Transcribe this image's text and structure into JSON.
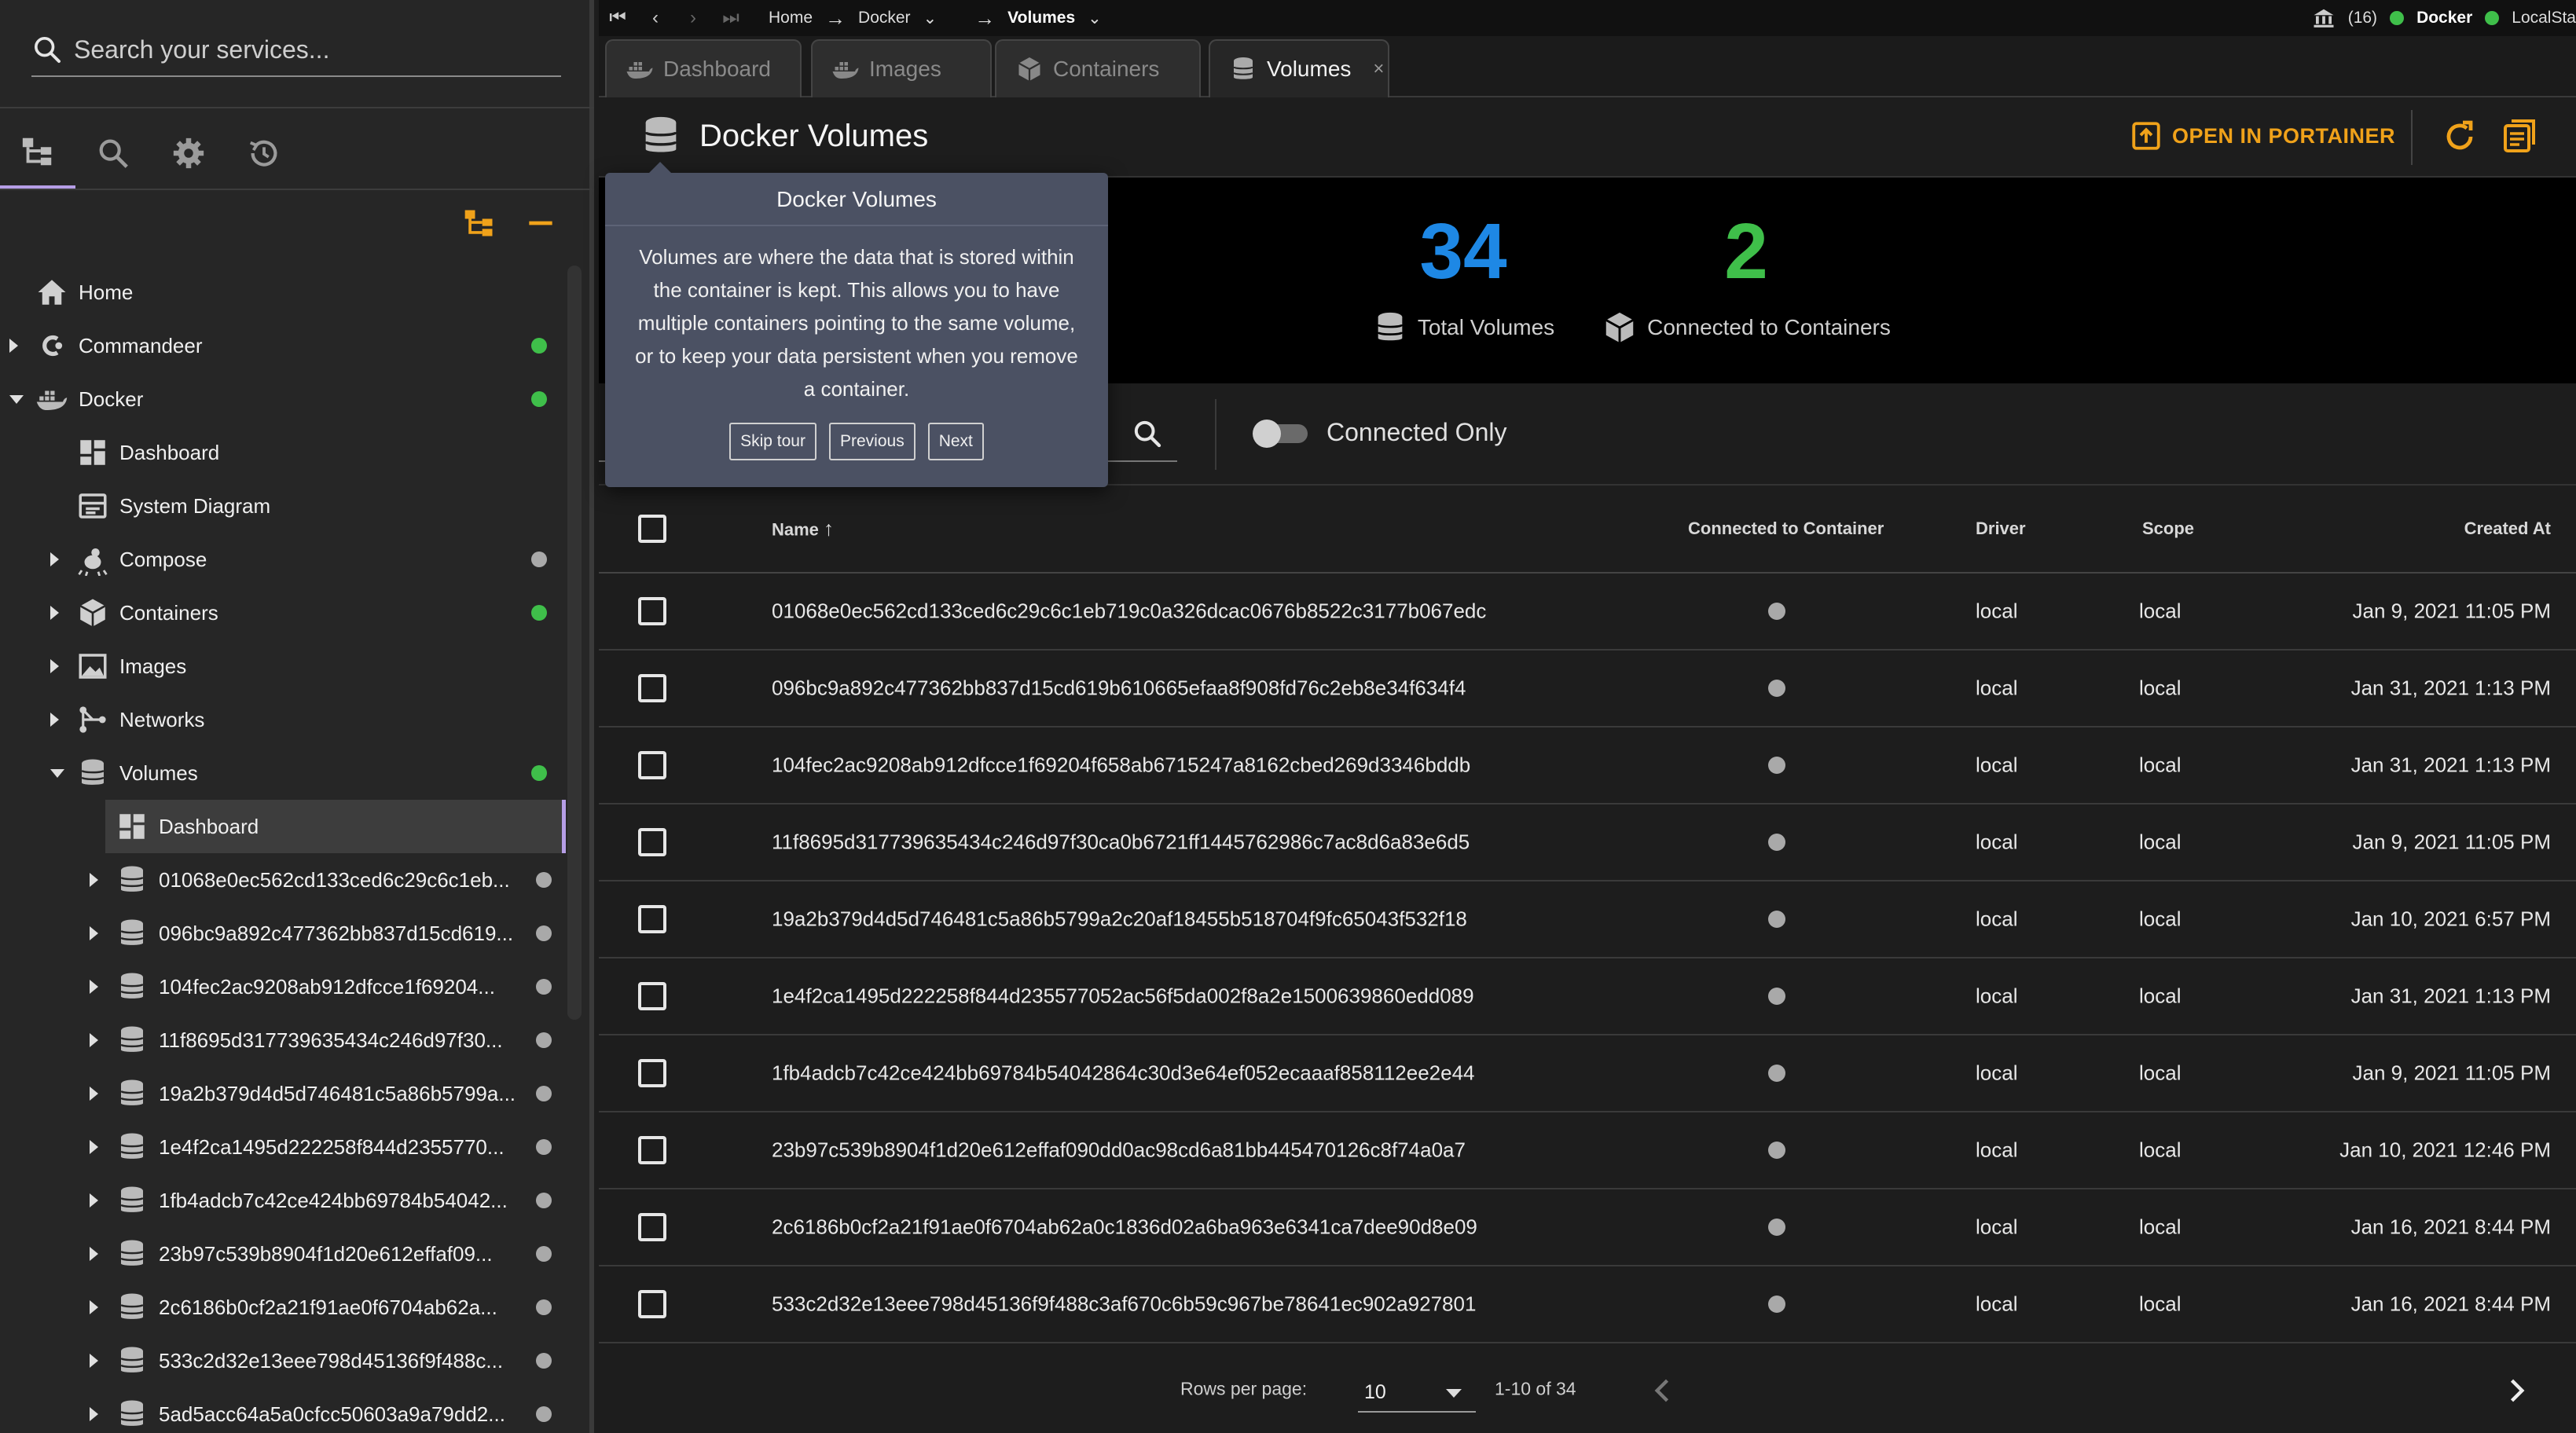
{
  "colors": {
    "accent_purple": "#b69ee6",
    "green": "#3fbf4a",
    "blue": "#1e88e5",
    "orange": "#f0a21a",
    "gray_dot": "#a9a9a9"
  },
  "sidebar": {
    "search_placeholder": "Search your services...",
    "tools": [
      "tree-icon",
      "search-icon",
      "gear-icon",
      "history-icon"
    ],
    "tree": [
      {
        "label": "Home",
        "icon": "home-icon",
        "level": 0,
        "caret": "none",
        "status": "none"
      },
      {
        "label": "Commandeer",
        "icon": "commandeer-icon",
        "level": 0,
        "caret": "right",
        "status": "green"
      },
      {
        "label": "Docker",
        "icon": "docker-icon",
        "level": 0,
        "caret": "down",
        "status": "green"
      },
      {
        "label": "Dashboard",
        "icon": "dashboard-icon",
        "level": 1,
        "caret": "none",
        "status": "none"
      },
      {
        "label": "System Diagram",
        "icon": "diagram-icon",
        "level": 1,
        "caret": "none",
        "status": "none"
      },
      {
        "label": "Compose",
        "icon": "compose-icon",
        "level": 1,
        "caret": "right",
        "status": "gray"
      },
      {
        "label": "Containers",
        "icon": "container-icon",
        "level": 1,
        "caret": "right",
        "status": "green"
      },
      {
        "label": "Images",
        "icon": "image-icon",
        "level": 1,
        "caret": "right",
        "status": "none"
      },
      {
        "label": "Networks",
        "icon": "network-icon",
        "level": 1,
        "caret": "right",
        "status": "none"
      },
      {
        "label": "Volumes",
        "icon": "volume-icon",
        "level": 1,
        "caret": "down",
        "status": "green"
      },
      {
        "label": "Dashboard",
        "icon": "dashboard-icon",
        "level": 2,
        "caret": "none",
        "status": "none",
        "selected": true
      },
      {
        "label": "01068e0ec562cd133ced6c29c6c1eb...",
        "icon": "volume-icon",
        "level": 2,
        "caret": "right",
        "status": "gray"
      },
      {
        "label": "096bc9a892c477362bb837d15cd619...",
        "icon": "volume-icon",
        "level": 2,
        "caret": "right",
        "status": "gray"
      },
      {
        "label": "104fec2ac9208ab912dfcce1f69204...",
        "icon": "volume-icon",
        "level": 2,
        "caret": "right",
        "status": "gray"
      },
      {
        "label": "11f8695d317739635434c246d97f30...",
        "icon": "volume-icon",
        "level": 2,
        "caret": "right",
        "status": "gray"
      },
      {
        "label": "19a2b379d4d5d746481c5a86b5799a...",
        "icon": "volume-icon",
        "level": 2,
        "caret": "right",
        "status": "gray"
      },
      {
        "label": "1e4f2ca1495d222258f844d2355770...",
        "icon": "volume-icon",
        "level": 2,
        "caret": "right",
        "status": "gray"
      },
      {
        "label": "1fb4adcb7c42ce424bb69784b54042...",
        "icon": "volume-icon",
        "level": 2,
        "caret": "right",
        "status": "gray"
      },
      {
        "label": "23b97c539b8904f1d20e612effaf09...",
        "icon": "volume-icon",
        "level": 2,
        "caret": "right",
        "status": "gray"
      },
      {
        "label": "2c6186b0cf2a21f91ae0f6704ab62a...",
        "icon": "volume-icon",
        "level": 2,
        "caret": "right",
        "status": "gray"
      },
      {
        "label": "533c2d32e13eee798d45136f9f488c...",
        "icon": "volume-icon",
        "level": 2,
        "caret": "right",
        "status": "gray"
      },
      {
        "label": "5ad5acc64a5a0cfcc50603a9a79dd2...",
        "icon": "volume-icon",
        "level": 2,
        "caret": "right",
        "status": "gray"
      }
    ]
  },
  "topbar": {
    "breadcrumbs": [
      "Home",
      "Docker",
      "Volumes"
    ],
    "notification_count": "(16)",
    "env1": "Docker",
    "env2": "LocalSta"
  },
  "tabs": [
    {
      "label": "Dashboard",
      "icon": "docker-icon",
      "active": false
    },
    {
      "label": "Images",
      "icon": "docker-icon",
      "active": false
    },
    {
      "label": "Containers",
      "icon": "container-icon",
      "active": false
    },
    {
      "label": "Volumes",
      "icon": "volume-icon",
      "active": true,
      "close": "×"
    }
  ],
  "header": {
    "title": "Docker Volumes",
    "open_portainer": "OPEN IN PORTAINER"
  },
  "stats": {
    "total_volumes": "34",
    "total_label": "Total Volumes",
    "connected": "2",
    "connected_label": "Connected to Containers"
  },
  "filter": {
    "toggle_label": "Connected Only",
    "toggle_on": false
  },
  "table": {
    "columns": {
      "name": "Name",
      "connected": "Connected to Container",
      "driver": "Driver",
      "scope": "Scope",
      "created": "Created At"
    },
    "sort_arrow": "↑",
    "rows": [
      {
        "name": "01068e0ec562cd133ced6c29c6c1eb719c0a326dcac0676b8522c3177b067edc",
        "driver": "local",
        "scope": "local",
        "created": "Jan 9, 2021 11:05 PM"
      },
      {
        "name": "096bc9a892c477362bb837d15cd619b610665efaa8f908fd76c2eb8e34f634f4",
        "driver": "local",
        "scope": "local",
        "created": "Jan 31, 2021 1:13 PM"
      },
      {
        "name": "104fec2ac9208ab912dfcce1f69204f658ab6715247a8162cbed269d3346bddb",
        "driver": "local",
        "scope": "local",
        "created": "Jan 31, 2021 1:13 PM"
      },
      {
        "name": "11f8695d317739635434c246d97f30ca0b6721ff1445762986c7ac8d6a83e6d5",
        "driver": "local",
        "scope": "local",
        "created": "Jan 9, 2021 11:05 PM"
      },
      {
        "name": "19a2b379d4d5d746481c5a86b5799a2c20af18455b518704f9fc65043f532f18",
        "driver": "local",
        "scope": "local",
        "created": "Jan 10, 2021 6:57 PM"
      },
      {
        "name": "1e4f2ca1495d222258f844d235577052ac56f5da002f8a2e1500639860edd089",
        "driver": "local",
        "scope": "local",
        "created": "Jan 31, 2021 1:13 PM"
      },
      {
        "name": "1fb4adcb7c42ce424bb69784b54042864c30d3e64ef052ecaaaf858112ee2e44",
        "driver": "local",
        "scope": "local",
        "created": "Jan 9, 2021 11:05 PM"
      },
      {
        "name": "23b97c539b8904f1d20e612effaf090dd0ac98cd6a81bb445470126c8f74a0a7",
        "driver": "local",
        "scope": "local",
        "created": "Jan 10, 2021 12:46 PM"
      },
      {
        "name": "2c6186b0cf2a21f91ae0f6704ab62a0c1836d02a6ba963e6341ca7dee90d8e09",
        "driver": "local",
        "scope": "local",
        "created": "Jan 16, 2021 8:44 PM"
      },
      {
        "name": "533c2d32e13eee798d45136f9f488c3af670c6b59c967be78641ec902a927801",
        "driver": "local",
        "scope": "local",
        "created": "Jan 16, 2021 8:44 PM"
      }
    ]
  },
  "footer": {
    "rows_per_page_label": "Rows per page:",
    "rows_per_page": "10",
    "range": "1-10 of 34"
  },
  "tour": {
    "title": "Docker Volumes",
    "body": "Volumes are where the data that is stored within the container is kept. This allows you to have multiple containers pointing to the same volume, or to keep your data persistent when you remove a container.",
    "skip": "Skip tour",
    "previous": "Previous",
    "next": "Next"
  }
}
